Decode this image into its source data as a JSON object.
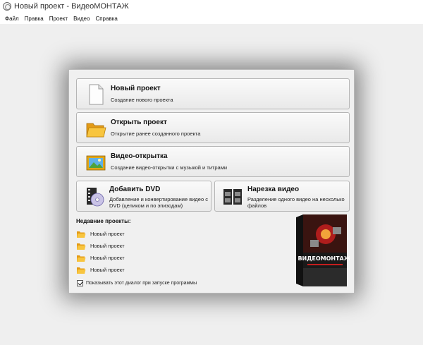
{
  "window": {
    "title": "Новый проект - ВидеоМОНТАЖ"
  },
  "menu": [
    "Файл",
    "Правка",
    "Проект",
    "Видео",
    "Справка"
  ],
  "dialog": {
    "new_project": {
      "title": "Новый проект",
      "subtitle": "Создание нового проекта"
    },
    "open_project": {
      "title": "Открыть проект",
      "subtitle": "Открытие ранее созданного проекта"
    },
    "video_card": {
      "title": "Видео-открытка",
      "subtitle": "Создание видео-открытки с музыкой и титрами"
    },
    "add_dvd": {
      "title": "Добавить DVD",
      "subtitle": "Добавление и конвертирование видео с DVD (целиком и по эпизодам)"
    },
    "split_video": {
      "title": "Нарезка видео",
      "subtitle": "Разделение одного видео на несколько файлов"
    },
    "recent_header": "Недавние проекты:",
    "recent": [
      "Новый проект",
      "Новый проект",
      "Новый проект",
      "Новый проект"
    ],
    "show_on_startup": {
      "label": "Показывать этот диалог при запуске программы",
      "checked": true
    },
    "product_box": {
      "name": "ВИДЕОМОНТАЖ"
    }
  },
  "colors": {
    "folder": "#f5b731",
    "box": "#1a1a1a",
    "box_accent": "#c41e1e"
  }
}
